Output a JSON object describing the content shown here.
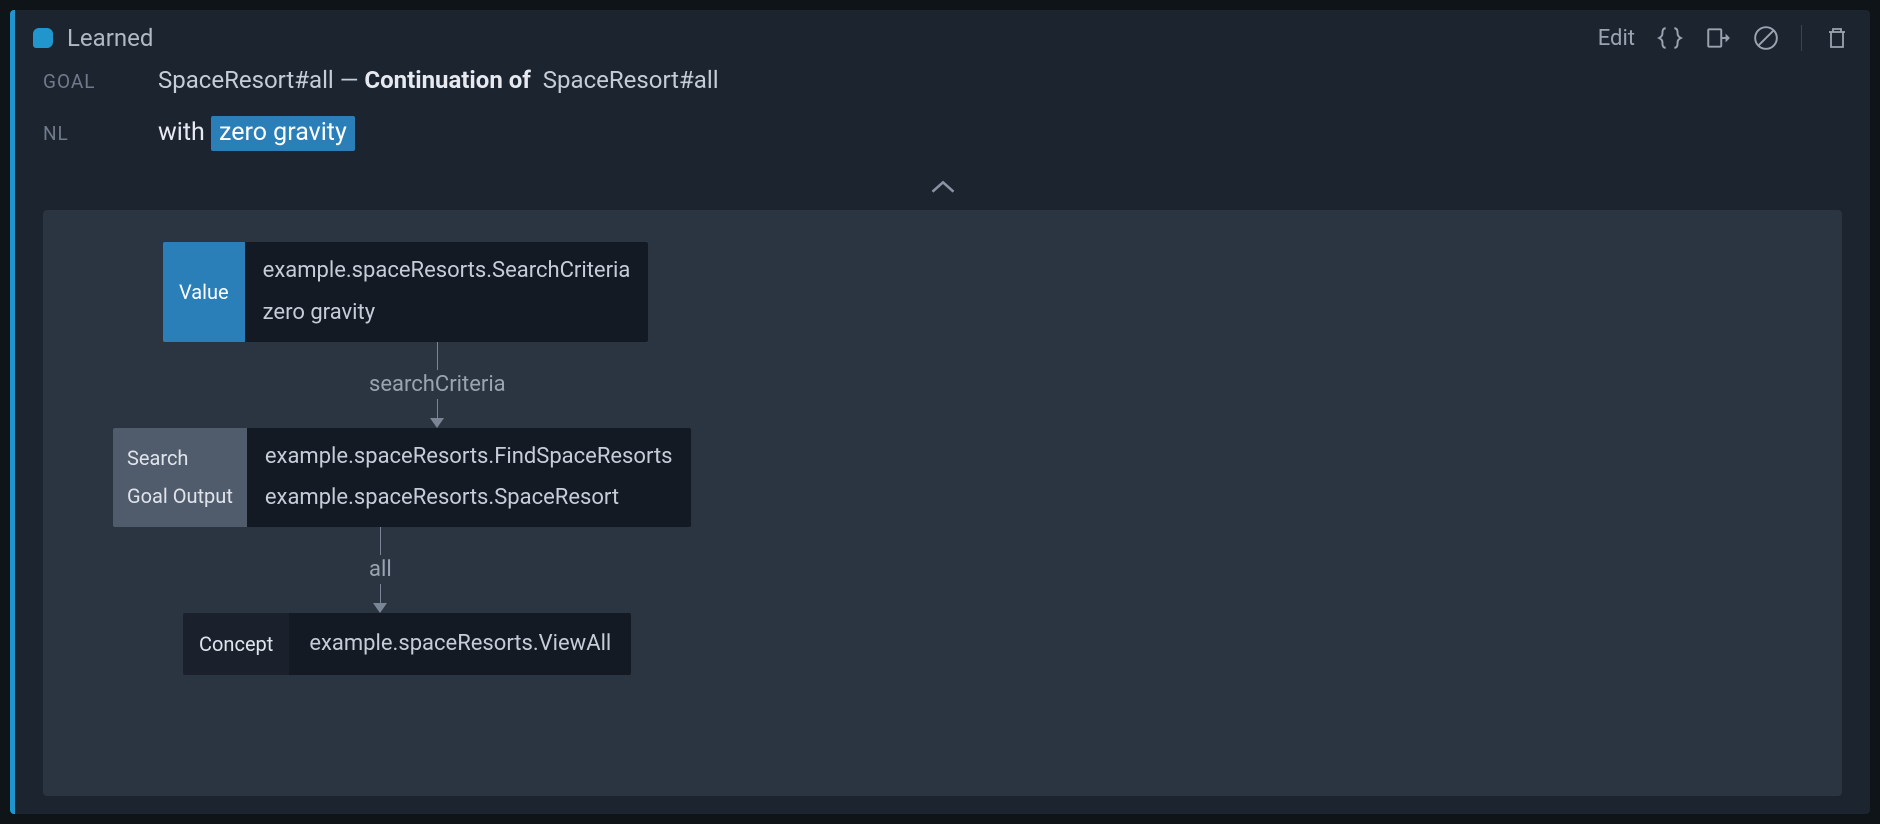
{
  "header": {
    "title": "Learned",
    "edit_label": "Edit"
  },
  "goal": {
    "label": "Goal",
    "entity1": "SpaceResort#all",
    "dash": " — ",
    "continuation_label": "Continuation of",
    "entity2": "SpaceResort#all"
  },
  "nl": {
    "label": "NL",
    "prefix": "with ",
    "highlight": "zero gravity"
  },
  "graph": {
    "node1": {
      "tag": "Value",
      "line1": "example.spaceResorts.SearchCriteria",
      "line2": "zero gravity"
    },
    "edge1_label": "searchCriteria",
    "node2": {
      "tag_line1": "Search",
      "tag_line2": "Goal Output",
      "line1": "example.spaceResorts.FindSpaceResorts",
      "line2": "example.spaceResorts.SpaceResort"
    },
    "edge2_label": "all",
    "node3": {
      "tag": "Concept",
      "line1": "example.spaceResorts.ViewAll"
    }
  }
}
